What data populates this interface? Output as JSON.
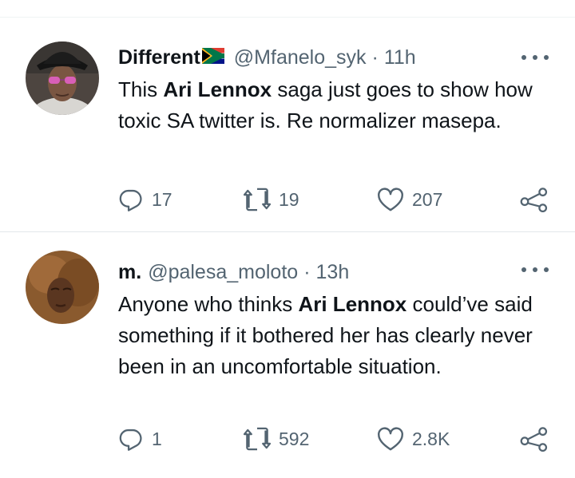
{
  "tweets": [
    {
      "display_name": "Different",
      "handle": "@Mfanelo_syk",
      "separator": "·",
      "time": "11h",
      "text_before": "This ",
      "text_bold": "Ari Lennox",
      "text_after": " saga just goes to show how toxic SA twitter is. Re normalizer masepa.",
      "replies": "17",
      "retweets": "19",
      "likes": "207",
      "icons": {
        "more": "more-horizontal-icon",
        "reply": "reply-icon",
        "retweet": "retweet-icon",
        "like": "heart-icon",
        "share": "share-icon",
        "flag": "south-africa-flag-icon"
      }
    },
    {
      "display_name": "m.",
      "handle": "@palesa_moloto",
      "separator": "·",
      "time": "13h",
      "text_before": "Anyone who thinks ",
      "text_bold": "Ari Lennox",
      "text_after": " could’ve said something if it bothered her has clearly never been in an uncomfortable situation.",
      "replies": "1",
      "retweets": "592",
      "likes": "2.8K",
      "icons": {
        "more": "more-horizontal-icon",
        "reply": "reply-icon",
        "retweet": "retweet-icon",
        "like": "heart-icon",
        "share": "share-icon"
      }
    }
  ],
  "colors": {
    "text": "#0f1419",
    "secondary": "#536471",
    "divider": "#eff3f4"
  }
}
